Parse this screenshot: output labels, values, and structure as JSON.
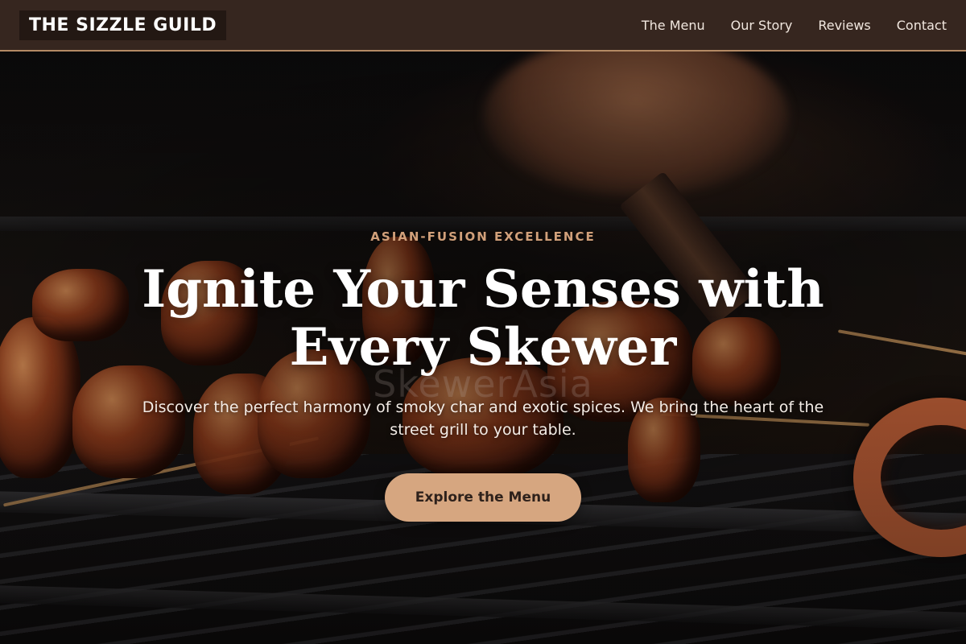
{
  "header": {
    "logo": "THE SIZZLE GUILD",
    "nav": [
      {
        "label": "The Menu"
      },
      {
        "label": "Our Story"
      },
      {
        "label": "Reviews"
      },
      {
        "label": "Contact"
      }
    ]
  },
  "hero": {
    "eyebrow": "ASIAN-FUSION EXCELLENCE",
    "headline": "Ignite Your Senses with Every Skewer",
    "watermark": "SkewerAsia",
    "subtext": "Discover the perfect harmony of smoky char and exotic spices. We bring the heart of the street grill to your table.",
    "cta_label": "Explore the Menu",
    "background_image": "grilled-skewers-photo"
  },
  "colors": {
    "header_bg": "#36261f",
    "header_border": "#b48a64",
    "logo_bg": "#231813",
    "accent": "#d1a07a",
    "cta_bg": "#d6a680",
    "cta_text": "#2e211b",
    "text_light": "#ffffff"
  }
}
